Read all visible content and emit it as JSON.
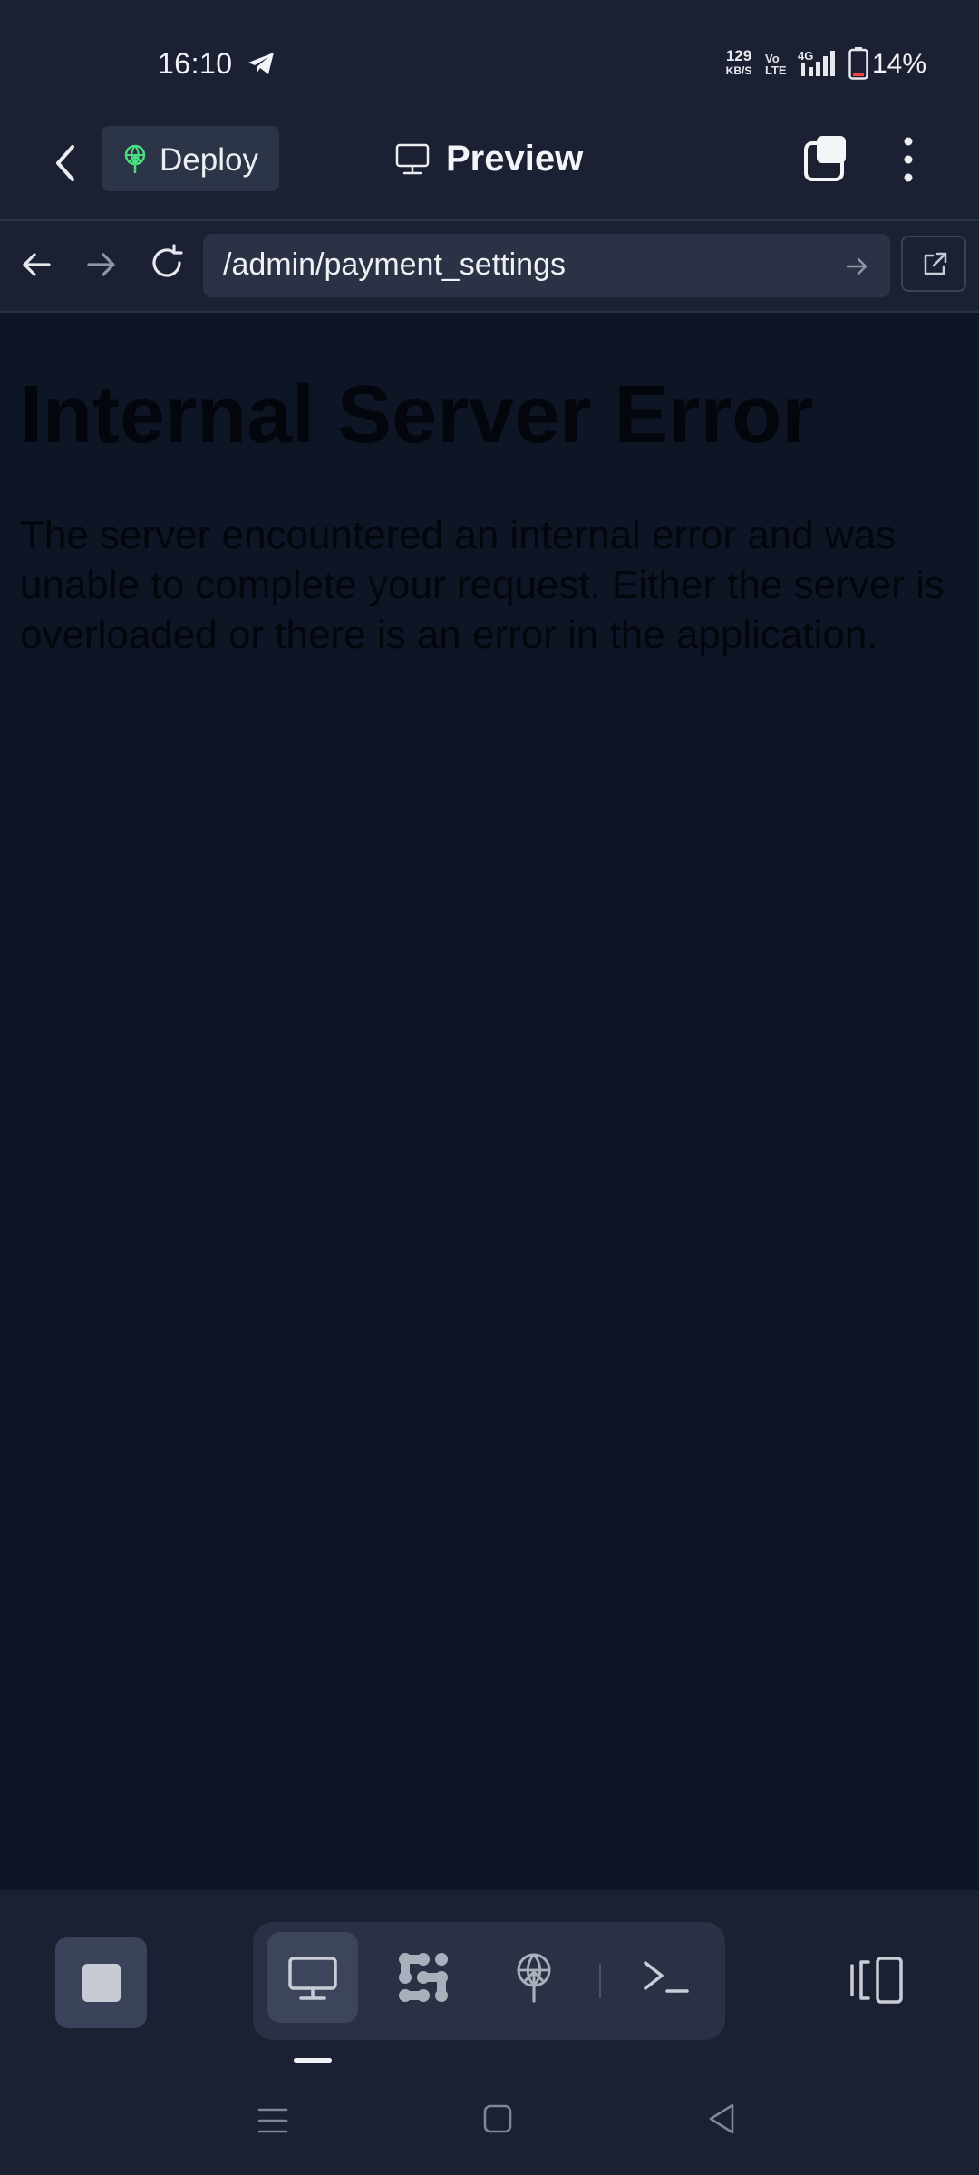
{
  "status_bar": {
    "time": "16:10",
    "net_speed_value": "129",
    "net_speed_unit": "KB/S",
    "volte_top": "Vo",
    "volte_bottom": "LTE",
    "network_type": "4G",
    "battery_percent": "14%",
    "icons": [
      "telegram-icon",
      "signal-icon",
      "battery-icon"
    ]
  },
  "app_bar": {
    "deploy_label": "Deploy",
    "title": "Preview",
    "accent_color": "#4ade80",
    "icons": [
      "chevron-left-icon",
      "deploy-icon",
      "monitor-icon",
      "tabs-icon",
      "kebab-menu-icon"
    ]
  },
  "url_bar": {
    "url": "/admin/payment_settings",
    "icons": [
      "arrow-left-icon",
      "arrow-right-icon",
      "reload-icon",
      "arrow-right-icon",
      "open-external-icon"
    ]
  },
  "page": {
    "heading": "Internal Server Error",
    "body": "The server encountered an internal error and was unable to complete your request. Either the server is overloaded or there is an error in the application."
  },
  "bottom_toolbar": {
    "active_tool": "webview",
    "tools": [
      "monitor-icon",
      "components-icon",
      "deploy-icon",
      "terminal-icon"
    ],
    "icons": [
      "stop-icon",
      "layout-toggle-icon"
    ]
  },
  "system_nav": {
    "icons": [
      "menu-icon",
      "home-icon",
      "back-icon"
    ]
  }
}
